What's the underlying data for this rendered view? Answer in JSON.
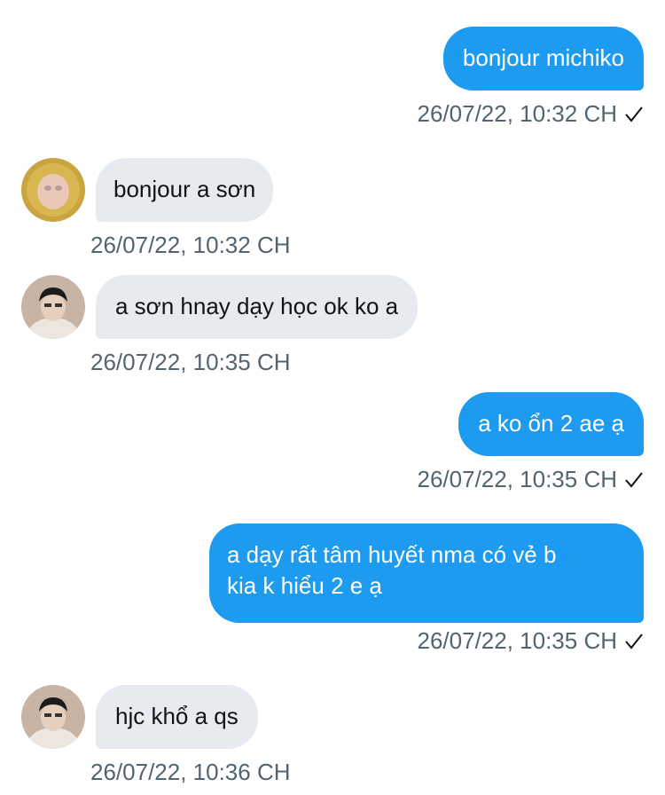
{
  "conversation": {
    "messages": [
      {
        "sender": "me",
        "text": "bonjour michiko",
        "time": "26/07/22, 10:32 CH",
        "status_icon": "check-icon"
      },
      {
        "sender": "michiko",
        "avatar_icon": "contact-avatar-yellow",
        "text": "bonjour a sơn",
        "time": "26/07/22, 10:32 CH"
      },
      {
        "sender": "contact",
        "avatar_icon": "contact-avatar-dark-hair",
        "text": "a sơn hnay dạy học ok ko a",
        "time": "26/07/22, 10:35 CH"
      },
      {
        "sender": "me",
        "text": "a ko ổn 2 ae ạ",
        "time": "26/07/22, 10:35 CH",
        "status_icon": "check-icon"
      },
      {
        "sender": "me",
        "text": "a dạy rất tâm huyết nma có vẻ b\nkia k hiểu 2 e ạ",
        "time": "26/07/22, 10:35 CH",
        "status_icon": "check-icon"
      },
      {
        "sender": "contact",
        "avatar_icon": "contact-avatar-dark-hair",
        "text": "hjc khổ a qs",
        "time": "26/07/22, 10:36 CH"
      }
    ]
  },
  "colors": {
    "sent_bubble": "#1d9bf0",
    "received_bubble": "#e7ebef",
    "timestamp": "#536471"
  }
}
